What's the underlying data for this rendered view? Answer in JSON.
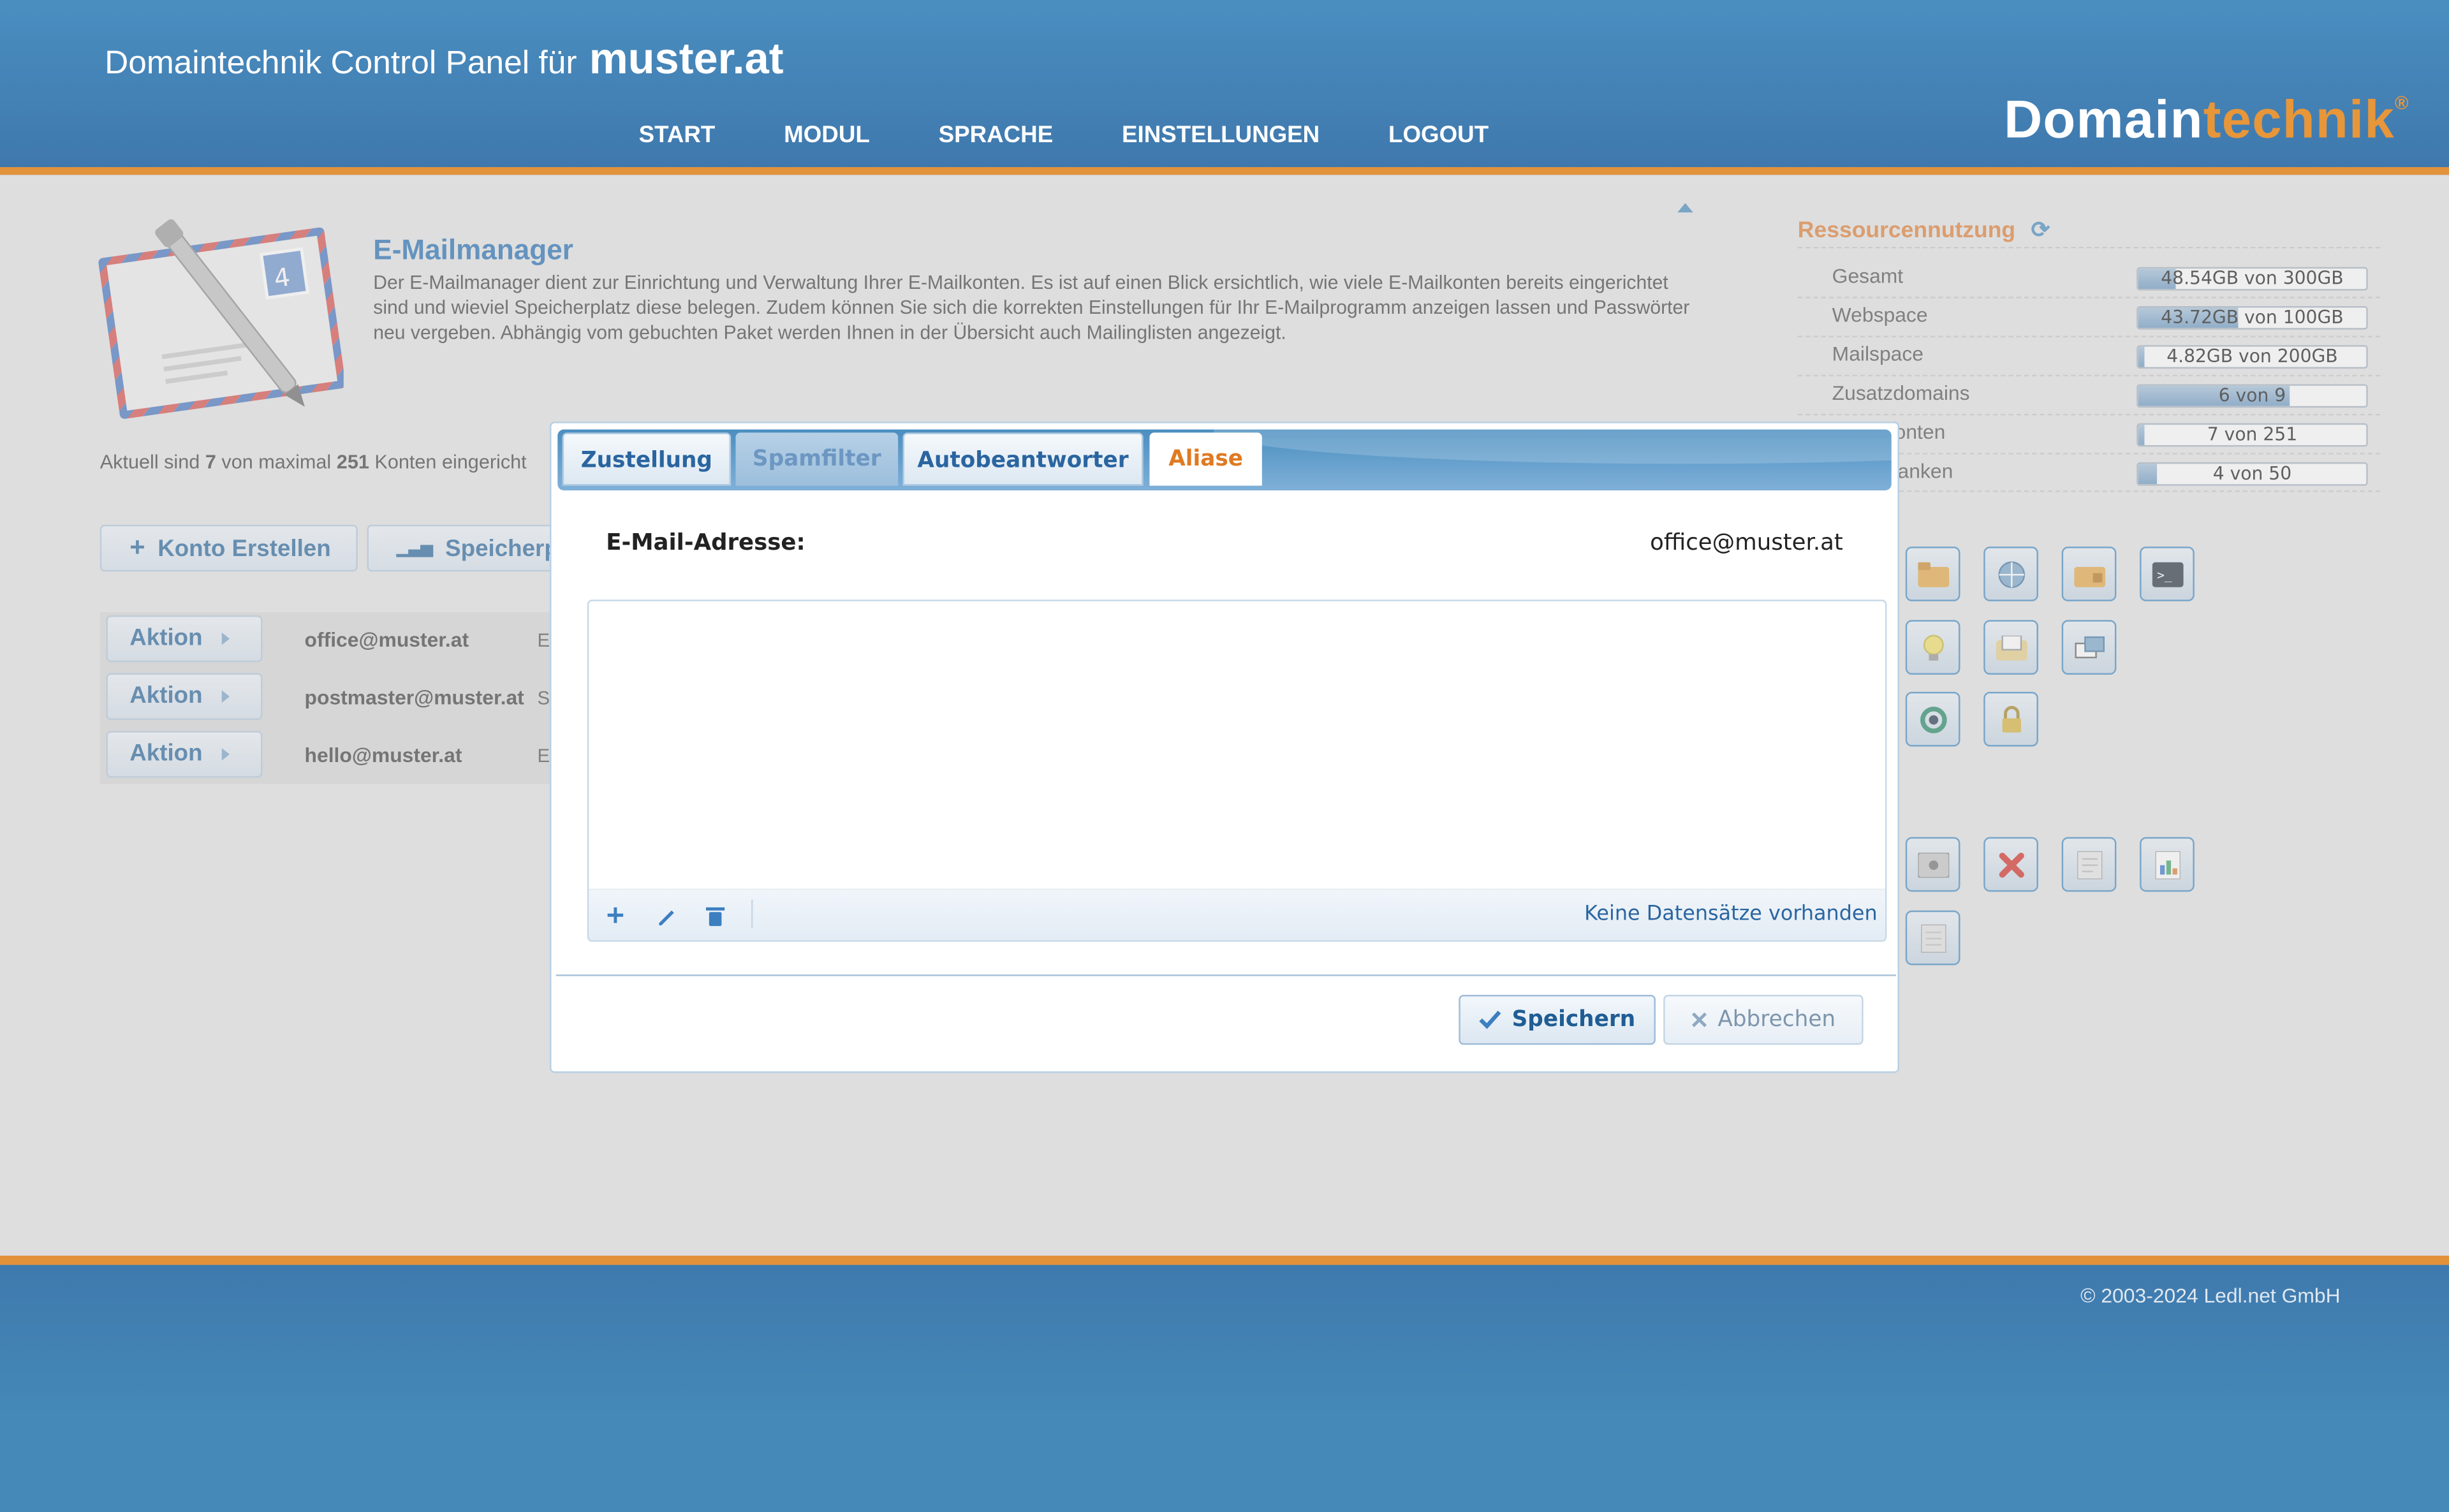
{
  "header": {
    "title_prefix": "Domaintechnik Control Panel für",
    "domain": "muster.at",
    "nav": [
      "START",
      "MODUL",
      "SPRACHE",
      "EINSTELLUNGEN",
      "LOGOUT"
    ],
    "brand_part1": "Domain",
    "brand_part2": "technik",
    "brand_mark": "®"
  },
  "app": {
    "title": "E-Mailmanager",
    "description": "Der E-Mailmanager dient zur Einrichtung und Verwaltung Ihrer E-Mailkonten. Es ist auf einen Blick ersichtlich, wie viele E-Mailkonten bereits eingerichtet sind und wieviel Speicherplatz diese belegen. Zudem können Sie sich die korrekten Einstellungen für Ihr E-Mailprogramm anzeigen lassen und Passwörter neu vergeben. Abhängig vom gebuchten Paket werden Ihnen in der Übersicht auch Mailinglisten angezeigt.",
    "accounts_prefix": "Aktuell sind",
    "accounts_current": "7",
    "accounts_mid": "von maximal",
    "accounts_max": "251",
    "accounts_suffix": "Konten eingericht",
    "create_button": "Konto Erstellen",
    "storage_button": "Speicherpl"
  },
  "accounts": [
    {
      "action": "Aktion",
      "email": "office@muster.at",
      "extra": "E"
    },
    {
      "action": "Aktion",
      "email": "postmaster@muster.at",
      "extra": "S"
    },
    {
      "action": "Aktion",
      "email": "hello@muster.at",
      "extra": "E"
    }
  ],
  "resources": {
    "title": "Ressourcennutzung",
    "items": [
      {
        "label": "Gesamt",
        "value": "48.54GB von 300GB",
        "fraction": 0.162
      },
      {
        "label": "Webspace",
        "value": "43.72GB von 100GB",
        "fraction": 0.437
      },
      {
        "label": "Mailspace",
        "value": "4.82GB von 200GB",
        "fraction": 0.024
      },
      {
        "label": "Zusatzdomains",
        "value": "6 von 9",
        "fraction": 0.667
      },
      {
        "label": "onten",
        "value": "7 von 251",
        "fraction": 0.028
      },
      {
        "label": "anken",
        "value": "4 von 50",
        "fraction": 0.08
      }
    ]
  },
  "modal": {
    "tabs": [
      "Zustellung",
      "Spamfilter",
      "Autobeantworter",
      "Aliase"
    ],
    "active_tab": "Aliase",
    "email_label": "E-Mail-Adresse:",
    "email_value": "office@muster.at",
    "grid_empty": "Keine Datensätze vorhanden",
    "save_label": "Speichern",
    "cancel_label": "Abbrechen"
  },
  "footer": {
    "copyright": "© 2003-2024 Ledl.net GmbH"
  },
  "colors": {
    "header_blue": "#4489b8",
    "accent_orange": "#e3923c",
    "link_blue": "#2a72b6",
    "active_tab_orange": "#e07a22"
  },
  "icons": {
    "grid_row1": [
      "folder-icon",
      "web-icon",
      "folder-lock-icon",
      "terminal-icon"
    ],
    "grid_row2": [
      "lightbulb-icon",
      "mail-folder-icon",
      "transfer-icon"
    ],
    "grid_row3": [
      "sync-icon",
      "lock-icon"
    ],
    "grid_row4": [
      "settings-icon",
      "delete-icon",
      "document-icon",
      "chart-icon"
    ],
    "grid_row5": [
      "notes-icon"
    ]
  }
}
